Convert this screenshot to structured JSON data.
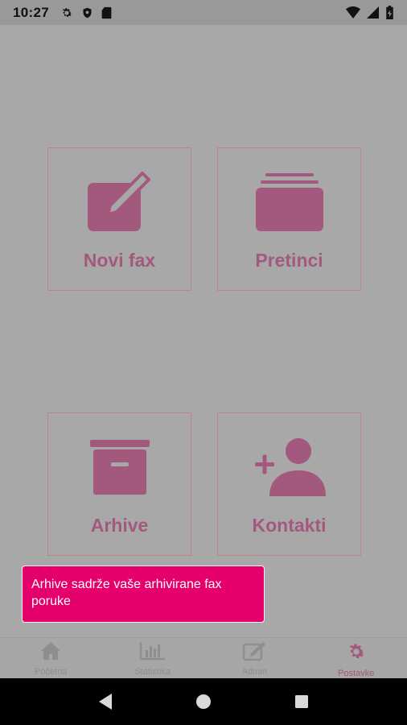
{
  "status_bar": {
    "time": "10:27",
    "left_icons": [
      "gear-icon",
      "shield-icon",
      "sd-card-icon"
    ],
    "right_icons": [
      "wifi-icon",
      "signal-icon",
      "battery-charging-icon"
    ]
  },
  "tiles": [
    {
      "label": "Novi fax",
      "icon": "edit-icon"
    },
    {
      "label": "Pretinci",
      "icon": "inbox-stack-icon"
    },
    {
      "label": "Arhive",
      "icon": "archive-box-icon"
    },
    {
      "label": "Kontakti",
      "icon": "add-contact-icon"
    }
  ],
  "toast": {
    "text": "Arhive sadrže vaše arhivirane fax poruke"
  },
  "bottom_nav": {
    "items": [
      {
        "label": "Početna",
        "icon": "home-icon"
      },
      {
        "label": "Statistika",
        "icon": "bar-chart-icon"
      },
      {
        "label": "Admin",
        "icon": "edit-icon"
      },
      {
        "label": "Postavke",
        "icon": "gear-icon",
        "active": true
      }
    ]
  },
  "colors": {
    "accent": "#a3587d",
    "toast_bg": "#e6006b",
    "overlay_bg": "#a8a8a8"
  }
}
